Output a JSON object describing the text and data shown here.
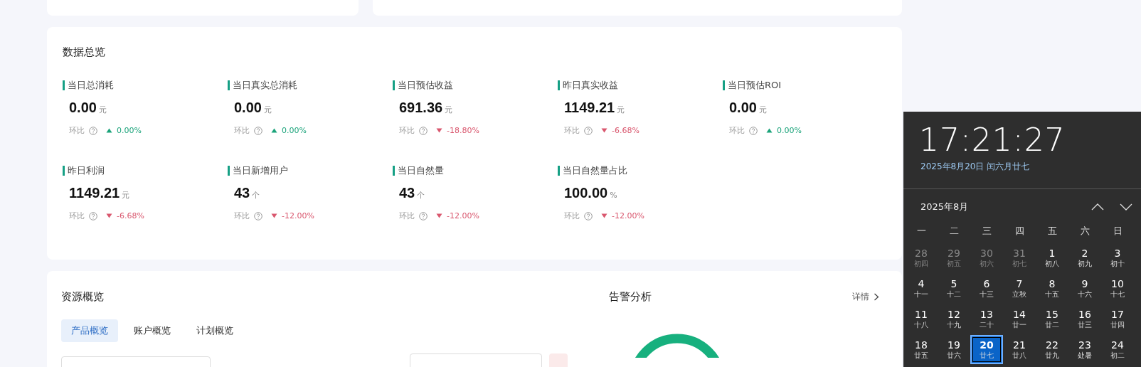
{
  "overview": {
    "title": "数据总览",
    "metrics": [
      {
        "label": "当日总消耗",
        "value": "0.00",
        "unit": "元",
        "compare_label": "环比",
        "rising": true,
        "change": "0.00%"
      },
      {
        "label": "当日真实总消耗",
        "value": "0.00",
        "unit": "元",
        "compare_label": "环比",
        "rising": true,
        "change": "0.00%"
      },
      {
        "label": "当日预估收益",
        "value": "691.36",
        "unit": "元",
        "compare_label": "环比",
        "rising": false,
        "change": "-18.80%"
      },
      {
        "label": "昨日真实收益",
        "value": "1149.21",
        "unit": "元",
        "compare_label": "环比",
        "rising": false,
        "change": "-6.68%"
      },
      {
        "label": "当日预估ROI",
        "value": "0.00",
        "unit": "元",
        "compare_label": "环比",
        "rising": true,
        "change": "0.00%"
      },
      {
        "label": "昨日利润",
        "value": "1149.21",
        "unit": "元",
        "compare_label": "环比",
        "rising": false,
        "change": "-6.68%"
      },
      {
        "label": "当日新增用户",
        "value": "43",
        "unit": "个",
        "compare_label": "环比",
        "rising": false,
        "change": "-12.00%"
      },
      {
        "label": "当日自然量",
        "value": "43",
        "unit": "个",
        "compare_label": "环比",
        "rising": false,
        "change": "-12.00%"
      },
      {
        "label": "当日自然量占比",
        "value": "100.00",
        "unit": "%",
        "compare_label": "环比",
        "rising": false,
        "change": "-12.00%"
      }
    ]
  },
  "resources": {
    "title": "资源概览",
    "tabs": [
      {
        "label": "产品概览",
        "selected": true
      },
      {
        "label": "账户概览",
        "selected": false
      },
      {
        "label": "计划概览",
        "selected": false
      }
    ]
  },
  "alerts": {
    "title": "告警分析",
    "details_link": "详情"
  },
  "calendar": {
    "time": "17:21:27",
    "date": "2025年8月20日 闰六月廿七",
    "month": "2025年8月",
    "weekdays": [
      "一",
      "二",
      "三",
      "四",
      "五",
      "六",
      "日"
    ],
    "days": [
      {
        "day": "28",
        "lunar": "初四",
        "in_month": false,
        "selected": false
      },
      {
        "day": "29",
        "lunar": "初五",
        "in_month": false,
        "selected": false
      },
      {
        "day": "30",
        "lunar": "初六",
        "in_month": false,
        "selected": false
      },
      {
        "day": "31",
        "lunar": "初七",
        "in_month": false,
        "selected": false
      },
      {
        "day": "1",
        "lunar": "初八",
        "in_month": true,
        "selected": false
      },
      {
        "day": "2",
        "lunar": "初九",
        "in_month": true,
        "selected": false
      },
      {
        "day": "3",
        "lunar": "初十",
        "in_month": true,
        "selected": false
      },
      {
        "day": "4",
        "lunar": "十一",
        "in_month": true,
        "selected": false
      },
      {
        "day": "5",
        "lunar": "十二",
        "in_month": true,
        "selected": false
      },
      {
        "day": "6",
        "lunar": "十三",
        "in_month": true,
        "selected": false
      },
      {
        "day": "7",
        "lunar": "立秋",
        "in_month": true,
        "selected": false
      },
      {
        "day": "8",
        "lunar": "十五",
        "in_month": true,
        "selected": false
      },
      {
        "day": "9",
        "lunar": "十六",
        "in_month": true,
        "selected": false
      },
      {
        "day": "10",
        "lunar": "十七",
        "in_month": true,
        "selected": false
      },
      {
        "day": "11",
        "lunar": "十八",
        "in_month": true,
        "selected": false
      },
      {
        "day": "12",
        "lunar": "十九",
        "in_month": true,
        "selected": false
      },
      {
        "day": "13",
        "lunar": "二十",
        "in_month": true,
        "selected": false
      },
      {
        "day": "14",
        "lunar": "廿一",
        "in_month": true,
        "selected": false
      },
      {
        "day": "15",
        "lunar": "廿二",
        "in_month": true,
        "selected": false
      },
      {
        "day": "16",
        "lunar": "廿三",
        "in_month": true,
        "selected": false
      },
      {
        "day": "17",
        "lunar": "廿四",
        "in_month": true,
        "selected": false
      },
      {
        "day": "18",
        "lunar": "廿五",
        "in_month": true,
        "selected": false
      },
      {
        "day": "19",
        "lunar": "廿六",
        "in_month": true,
        "selected": false
      },
      {
        "day": "20",
        "lunar": "廿七",
        "in_month": true,
        "selected": true
      },
      {
        "day": "21",
        "lunar": "廿八",
        "in_month": true,
        "selected": false
      },
      {
        "day": "22",
        "lunar": "廿九",
        "in_month": true,
        "selected": false
      },
      {
        "day": "23",
        "lunar": "处暑",
        "in_month": true,
        "selected": false
      },
      {
        "day": "24",
        "lunar": "初二",
        "in_month": true,
        "selected": false
      }
    ]
  }
}
